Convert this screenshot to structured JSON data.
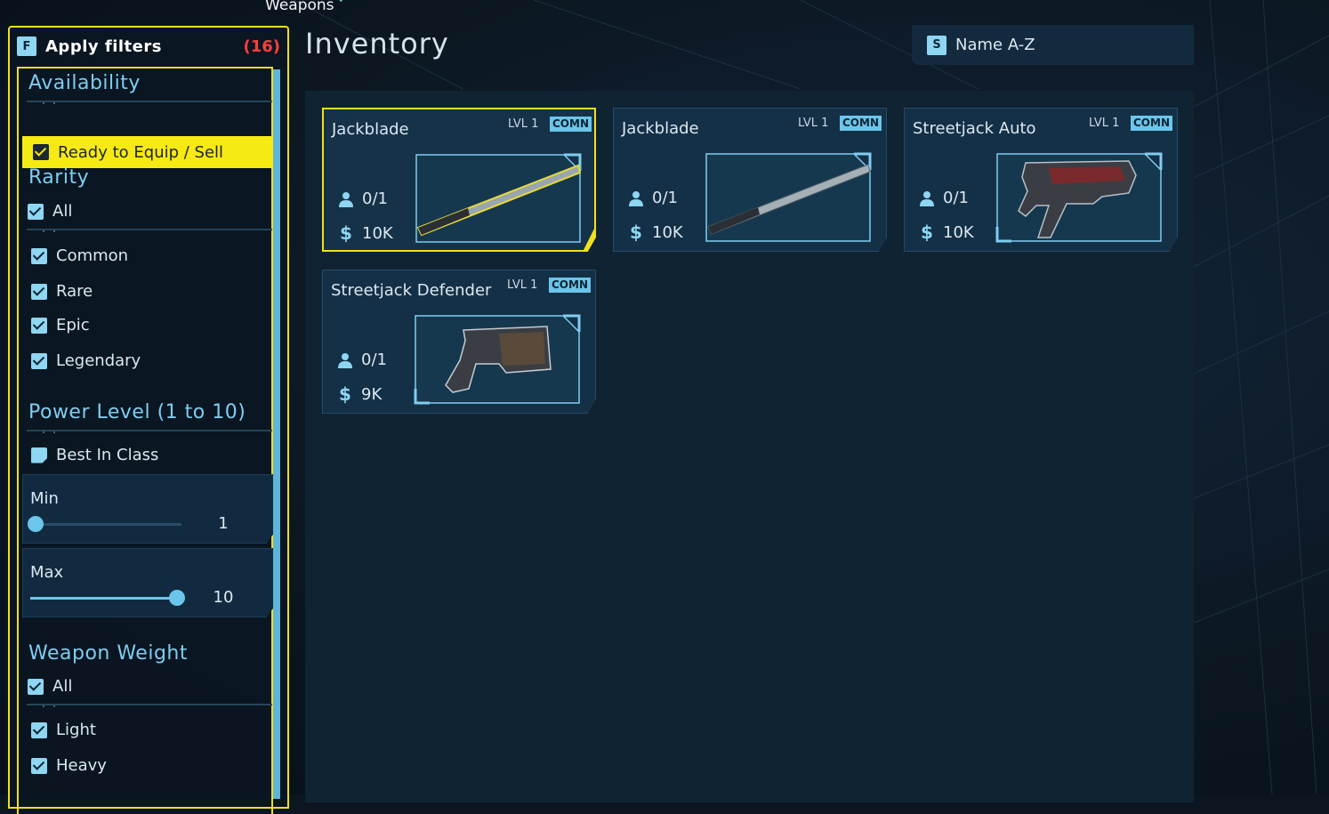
{
  "breadcrumb": "Weapons",
  "filters": {
    "key": "F",
    "title": "Apply filters",
    "count": "(16)",
    "availability": {
      "title": "Availability",
      "option": {
        "label": "Ready to Equip / Sell",
        "checked": true
      }
    },
    "rarity": {
      "title": "Rarity",
      "all_label": "All",
      "options": [
        {
          "label": "Common",
          "checked": true
        },
        {
          "label": "Rare",
          "checked": true
        },
        {
          "label": "Epic",
          "checked": true
        },
        {
          "label": "Legendary",
          "checked": true
        }
      ]
    },
    "power_level": {
      "title": "Power Level (1 to 10)",
      "best_in_class": {
        "label": "Best In Class",
        "checked": false
      },
      "min": {
        "label": "Min",
        "value": "1"
      },
      "max": {
        "label": "Max",
        "value": "10"
      }
    },
    "weight": {
      "title": "Weapon Weight",
      "all_label": "All",
      "options": [
        {
          "label": "Light",
          "checked": true
        },
        {
          "label": "Heavy",
          "checked": true
        }
      ]
    }
  },
  "inventory": {
    "title": "Inventory",
    "sort": {
      "key": "S",
      "label": "Name A-Z"
    },
    "items": [
      {
        "name": "Jackblade",
        "level": "LVL 1",
        "rarity": "COMN",
        "owned": "0/1",
        "price": "10K",
        "selected": true
      },
      {
        "name": "Jackblade",
        "level": "LVL 1",
        "rarity": "COMN",
        "owned": "0/1",
        "price": "10K",
        "selected": false
      },
      {
        "name": "Streetjack Auto",
        "level": "LVL 1",
        "rarity": "COMN",
        "owned": "0/1",
        "price": "10K",
        "selected": false
      },
      {
        "name": "Streetjack Defender",
        "level": "LVL 1",
        "rarity": "COMN",
        "owned": "0/1",
        "price": "9K",
        "selected": false
      }
    ]
  },
  "colors": {
    "accent_yellow": "#f2e01a",
    "accent_blue": "#6cc5ea",
    "count_red": "#ff3e3e"
  }
}
